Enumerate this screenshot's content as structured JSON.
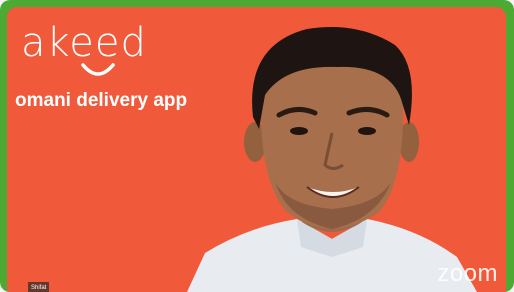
{
  "logo": {
    "word": "akeed",
    "tagline": "omani delivery app"
  },
  "participant": {
    "name": "Shifat"
  },
  "watermark": {
    "brand": "zoom"
  },
  "colors": {
    "frame": "#4caa32",
    "background": "#f05a3b",
    "text": "#ffffff"
  }
}
